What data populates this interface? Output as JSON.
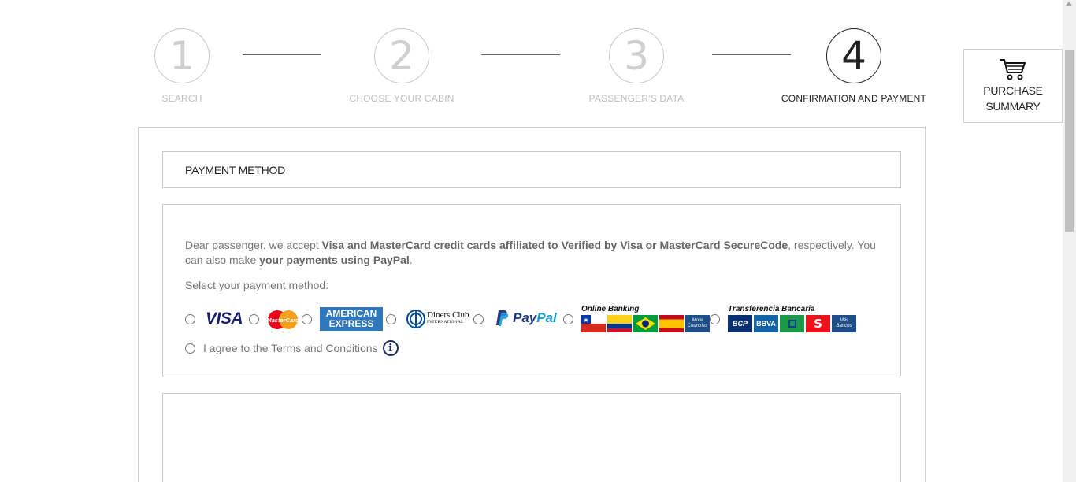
{
  "steps": [
    {
      "number": "1",
      "label": "SEARCH",
      "active": false
    },
    {
      "number": "2",
      "label": "CHOOSE YOUR CABIN",
      "active": false
    },
    {
      "number": "3",
      "label": "PASSENGER'S DATA",
      "active": false
    },
    {
      "number": "4",
      "label": "CONFIRMATION AND PAYMENT",
      "active": true
    }
  ],
  "summary": {
    "line1": "PURCHASE",
    "line2": "SUMMARY",
    "icon": "cart-icon"
  },
  "payment": {
    "header": "PAYMENT METHOD",
    "intro_part1": "Dear passenger, we accept ",
    "intro_bold1": "Visa and MasterCard credit cards affiliated to Verified by Visa or MasterCard SecureCode",
    "intro_part2": ", respectively. You can also make ",
    "intro_bold2": "your payments using PayPal",
    "intro_part3": ".",
    "select_label": "Select your payment method:",
    "methods": {
      "visa": "VISA",
      "mastercard": "MasterCard",
      "amex_line1": "AMERICAN",
      "amex_line2": "EXPRESS",
      "diners_line1": "Diners Club",
      "diners_line2": "INTERNATIONAL",
      "paypal_1": "Pay",
      "paypal_2": "Pal",
      "online_banking": "Online Banking",
      "more_countries": "More Countries",
      "transferencia": "Transferencia Bancaria",
      "bcp": "BCP",
      "bbva": "BBVA",
      "mas_bancos": "Más Bancos"
    },
    "agree_text": "I agree to the Terms and Conditions"
  },
  "colors": {
    "brand_navy": "#1f2e5a",
    "visa_blue": "#1a1f71",
    "amex_blue": "#2e77bc",
    "paypal_dark": "#253b80",
    "paypal_light": "#179bd7"
  }
}
